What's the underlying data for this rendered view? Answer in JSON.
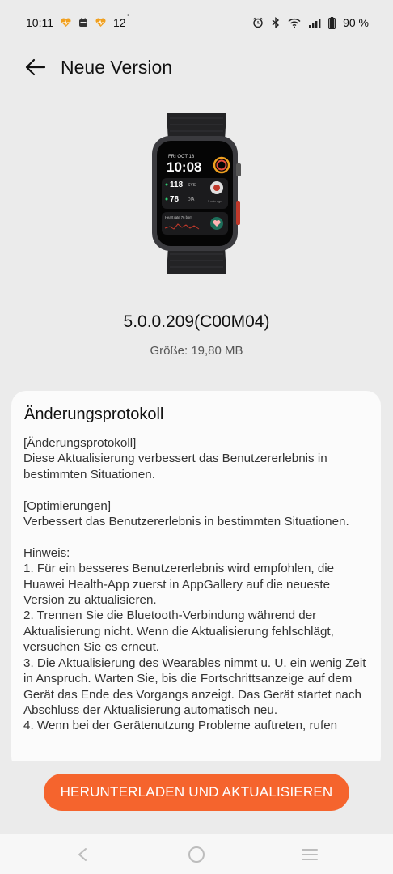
{
  "status_bar": {
    "time": "10:11",
    "notif_count": "12",
    "battery": "90 %",
    "icons": [
      "heart-notif-icon",
      "calendar-notif-icon",
      "heart-notif-icon",
      "alarm-icon",
      "bluetooth-icon",
      "wifi-icon",
      "signal-icon",
      "battery-icon"
    ]
  },
  "header": {
    "title": "Neue Version",
    "back_icon": "back-arrow-icon"
  },
  "watch": {
    "date": "FRI OCT 18",
    "time": "10:08",
    "sys_value": "118",
    "sys_label": "SYS",
    "dia_value": "78",
    "dia_label": "DIA",
    "ago": "5 min ago",
    "heart_rate": "Heart rate 76 bpm"
  },
  "version": "5.0.0.209(C00M04)",
  "size": "Größe: 19,80 MB",
  "changelog": {
    "title": "Änderungsprotokoll",
    "body": "[Änderungsprotokoll]\nDiese Aktualisierung verbessert das Benutzererlebnis in bestimmten Situationen.\n\n[Optimierungen]\nVerbessert das Benutzererlebnis in bestimmten Situationen.\n\nHinweis:\n1. Für ein besseres Benutzererlebnis wird empfohlen, die Huawei Health-App zuerst in AppGallery auf die neueste Version zu aktualisieren.\n2. Trennen Sie die Bluetooth-Verbindung während der Aktualisierung nicht. Wenn die Aktualisierung fehlschlägt, versuchen Sie es erneut.\n3. Die Aktualisierung des Wearables nimmt u. U. ein wenig Zeit in Anspruch. Warten Sie, bis die Fortschrittsanzeige auf dem Gerät das Ende des Vorgangs anzeigt. Das Gerät startet nach Abschluss der Aktualisierung automatisch neu.\n4. Wenn bei der Gerätenutzung Probleme auftreten, rufen"
  },
  "actions": {
    "download_label": "HERUNTERLADEN UND AKTUALISIEREN"
  },
  "colors": {
    "accent": "#f5642d",
    "background": "#ebebeb",
    "card": "#fbfbfb"
  },
  "nav": {
    "icons": [
      "nav-back-icon",
      "nav-home-icon",
      "nav-menu-icon"
    ]
  }
}
